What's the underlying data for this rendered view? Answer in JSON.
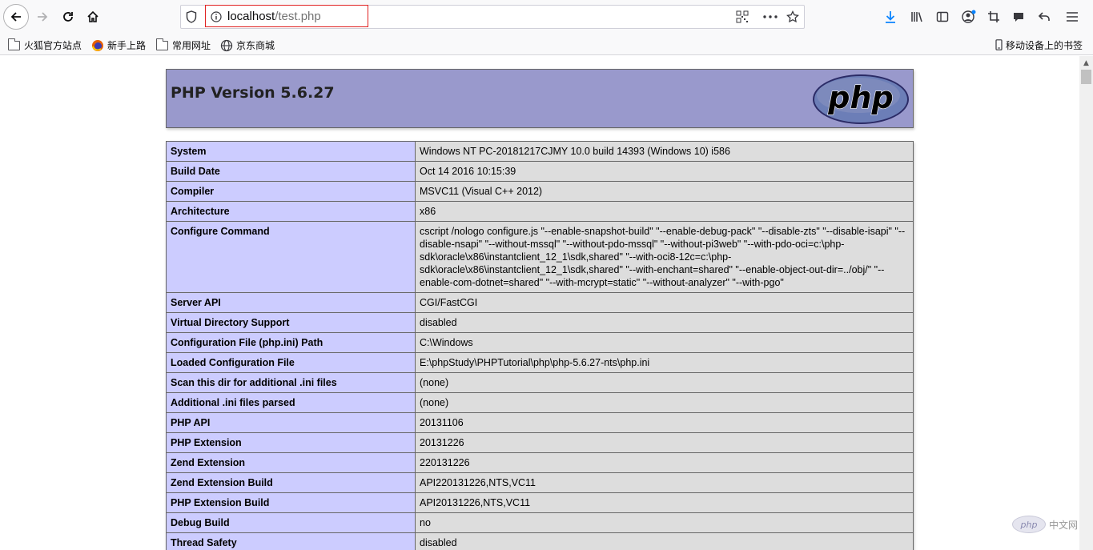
{
  "browser": {
    "url_host": "localhost",
    "url_path": "/test.php",
    "bookmarks": [
      {
        "label": "火狐官方站点",
        "icon": "folder-icon"
      },
      {
        "label": "新手上路",
        "icon": "firefox-icon"
      },
      {
        "label": "常用网址",
        "icon": "folder-icon"
      },
      {
        "label": "京东商城",
        "icon": "globe-icon"
      }
    ],
    "mobile_bookmarks_label": "移动设备上的书签"
  },
  "phpinfo": {
    "title": "PHP Version 5.6.27",
    "logo_text": "php",
    "rows": [
      {
        "key": "System",
        "value": "Windows NT PC-20181217CJMY 10.0 build 14393 (Windows 10) i586"
      },
      {
        "key": "Build Date",
        "value": "Oct 14 2016 10:15:39"
      },
      {
        "key": "Compiler",
        "value": "MSVC11 (Visual C++ 2012)"
      },
      {
        "key": "Architecture",
        "value": "x86"
      },
      {
        "key": "Configure Command",
        "value": "cscript /nologo configure.js \"--enable-snapshot-build\" \"--enable-debug-pack\" \"--disable-zts\" \"--disable-isapi\" \"--disable-nsapi\" \"--without-mssql\" \"--without-pdo-mssql\" \"--without-pi3web\" \"--with-pdo-oci=c:\\php-sdk\\oracle\\x86\\instantclient_12_1\\sdk,shared\" \"--with-oci8-12c=c:\\php-sdk\\oracle\\x86\\instantclient_12_1\\sdk,shared\" \"--with-enchant=shared\" \"--enable-object-out-dir=../obj/\" \"--enable-com-dotnet=shared\" \"--with-mcrypt=static\" \"--without-analyzer\" \"--with-pgo\""
      },
      {
        "key": "Server API",
        "value": "CGI/FastCGI"
      },
      {
        "key": "Virtual Directory Support",
        "value": "disabled"
      },
      {
        "key": "Configuration File (php.ini) Path",
        "value": "C:\\Windows"
      },
      {
        "key": "Loaded Configuration File",
        "value": "E:\\phpStudy\\PHPTutorial\\php\\php-5.6.27-nts\\php.ini"
      },
      {
        "key": "Scan this dir for additional .ini files",
        "value": "(none)"
      },
      {
        "key": "Additional .ini files parsed",
        "value": "(none)"
      },
      {
        "key": "PHP API",
        "value": "20131106"
      },
      {
        "key": "PHP Extension",
        "value": "20131226"
      },
      {
        "key": "Zend Extension",
        "value": "220131226"
      },
      {
        "key": "Zend Extension Build",
        "value": "API220131226,NTS,VC11"
      },
      {
        "key": "PHP Extension Build",
        "value": "API20131226,NTS,VC11"
      },
      {
        "key": "Debug Build",
        "value": "no"
      },
      {
        "key": "Thread Safety",
        "value": "disabled"
      }
    ]
  },
  "watermark": {
    "logo_text": "php",
    "text": "中文网"
  }
}
